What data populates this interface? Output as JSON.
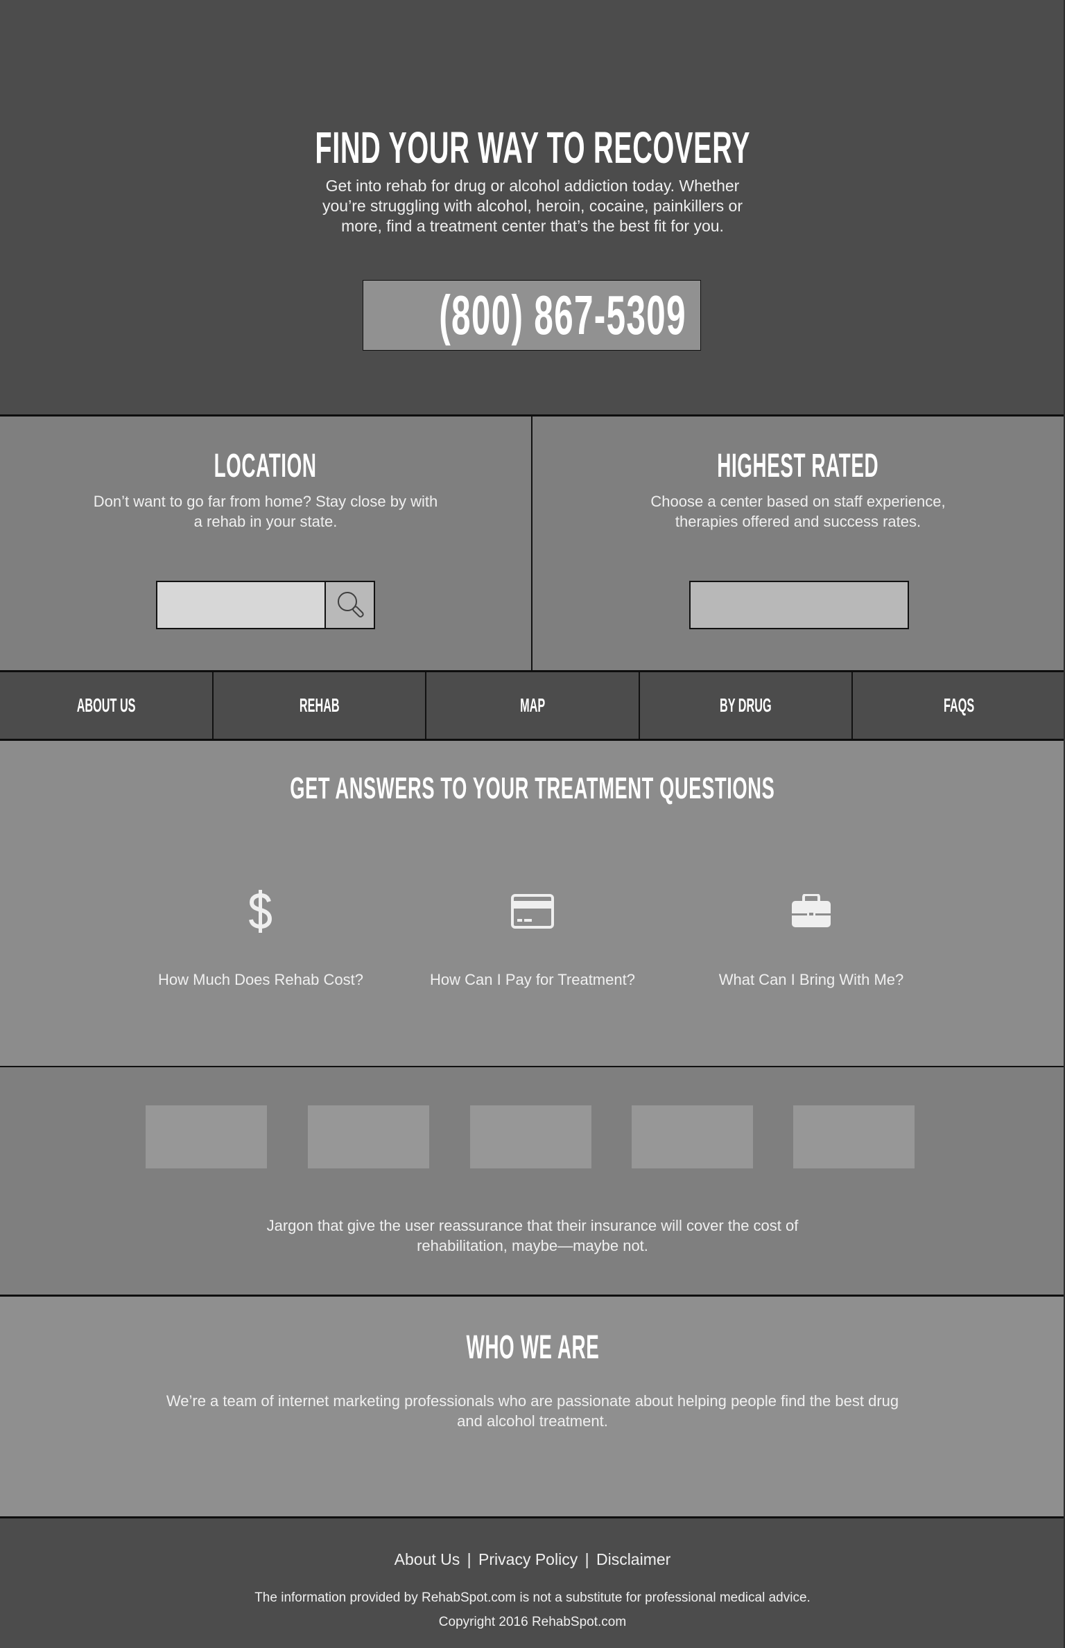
{
  "hero": {
    "title": "FIND YOUR WAY TO RECOVERY",
    "subtitle": "Get into rehab for drug or alcohol addiction today. Whether you’re struggling with alcohol, heroin, cocaine, painkillers or more, find a treatment center that’s the best fit for you.",
    "phone": "(800) 867-5309"
  },
  "location": {
    "title": "LOCATION",
    "description": "Don’t want to go far from home? Stay close by with a rehab in your state.",
    "search_value": "",
    "search_placeholder": "",
    "search_icon": "magnifier-icon"
  },
  "highest_rated": {
    "title": "HIGHEST RATED",
    "description": "Choose a center based on staff experience, therapies offered and success rates.",
    "selected_value": ""
  },
  "nav": {
    "items": [
      {
        "label": "ABOUT US"
      },
      {
        "label": "REHAB"
      },
      {
        "label": "MAP"
      },
      {
        "label": "BY DRUG"
      },
      {
        "label": "FAQS"
      }
    ]
  },
  "questions": {
    "title": "GET ANSWERS TO YOUR TREATMENT QUESTIONS",
    "items": [
      {
        "icon": "dollar-icon",
        "label": "How Much Does Rehab Cost?"
      },
      {
        "icon": "credit-card-icon",
        "label": "How Can I Pay for Treatment?"
      },
      {
        "icon": "briefcase-icon",
        "label": "What Can I Bring With Me?"
      }
    ]
  },
  "insurance": {
    "logo_count": 5,
    "text": "Jargon that give the user reassurance that their insurance will cover the cost of rehabilitation, maybe—maybe not."
  },
  "who_we_are": {
    "title": "WHO WE ARE",
    "text": "We’re a team of internet marketing professionals who are passionate about helping people find the best drug and alcohol treatment."
  },
  "footer": {
    "links": [
      {
        "label": "About Us"
      },
      {
        "label": "Privacy Policy"
      },
      {
        "label": "Disclaimer"
      }
    ],
    "separator": "|",
    "disclaimer": "The information provided by RehabSpot.com is not a substitute for professional medical advice.",
    "copyright": "Copyright 2016 RehabSpot.com"
  },
  "colors": {
    "dark_bg": "#4c4c4c",
    "mid_bg": "#7f7f7f",
    "light_bg": "#8c8c8c",
    "phone_box": "#919191",
    "input_bg": "#d7d7d7",
    "icon_fill": "#efefef",
    "border": "#111111",
    "text": "#ffffff"
  }
}
